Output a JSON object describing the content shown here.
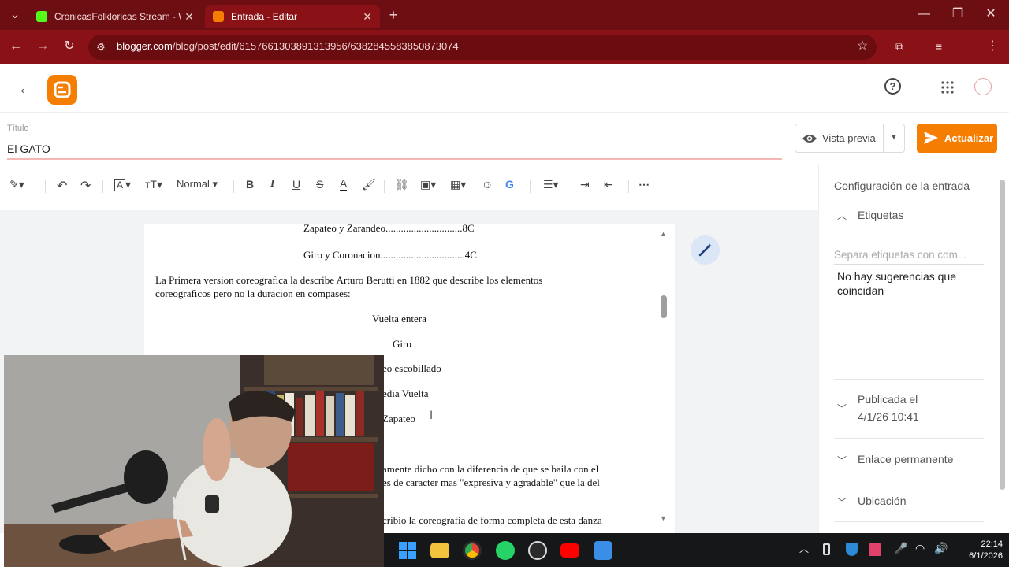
{
  "browser": {
    "tabs": [
      {
        "title": "CronicasFolkloricas Stream - W...",
        "active": false
      },
      {
        "title": "Entrada - Editar",
        "active": true
      }
    ],
    "url_domain": "blogger.com",
    "url_path": "/blog/post/edit/615766130389131395​6/6382845583850873074"
  },
  "post": {
    "title_label": "Título",
    "title_value": "El GATO"
  },
  "actions": {
    "preview": "Vista previa",
    "update": "Actualizar"
  },
  "toolbar": {
    "paragraph_style": "Normal"
  },
  "document": {
    "lines": [
      "Zapateo y Zarandeo..............................8C",
      "Giro y Coronacion.................................4C",
      "La Primera version coreografica la describe Arturo Berutti  en 1882 que describe los elementos",
      "coreograficos pero no la duracion en compases:",
      "Vuelta entera",
      "Giro",
      "eo escobillado",
      "edia Vuelta",
      "Zapateo",
      "amente dicho con la diferencia de que se baila con el",
      "es de caracter mas \"expresiva y agradable\" que la del",
      "cribio la coreografia de forma completa de esta danza"
    ]
  },
  "sidebar": {
    "header": "Configuración de la entrada",
    "labels_section": "Etiquetas",
    "labels_placeholder": "Separa etiquetas con com...",
    "no_suggestions": "No hay sugerencias que coincidan",
    "published_label": "Publicada el",
    "published_date": "4/1/26 10:41",
    "permalink": "Enlace permanente",
    "location": "Ubicación"
  },
  "taskbar": {
    "time": "22:14",
    "date": "6/1/2026"
  },
  "colors": {
    "browser_frame": "#6d0e12",
    "browser_toolbar": "#8a1116",
    "blogger_orange": "#f57d00",
    "title_underline": "#f4b7b3"
  }
}
